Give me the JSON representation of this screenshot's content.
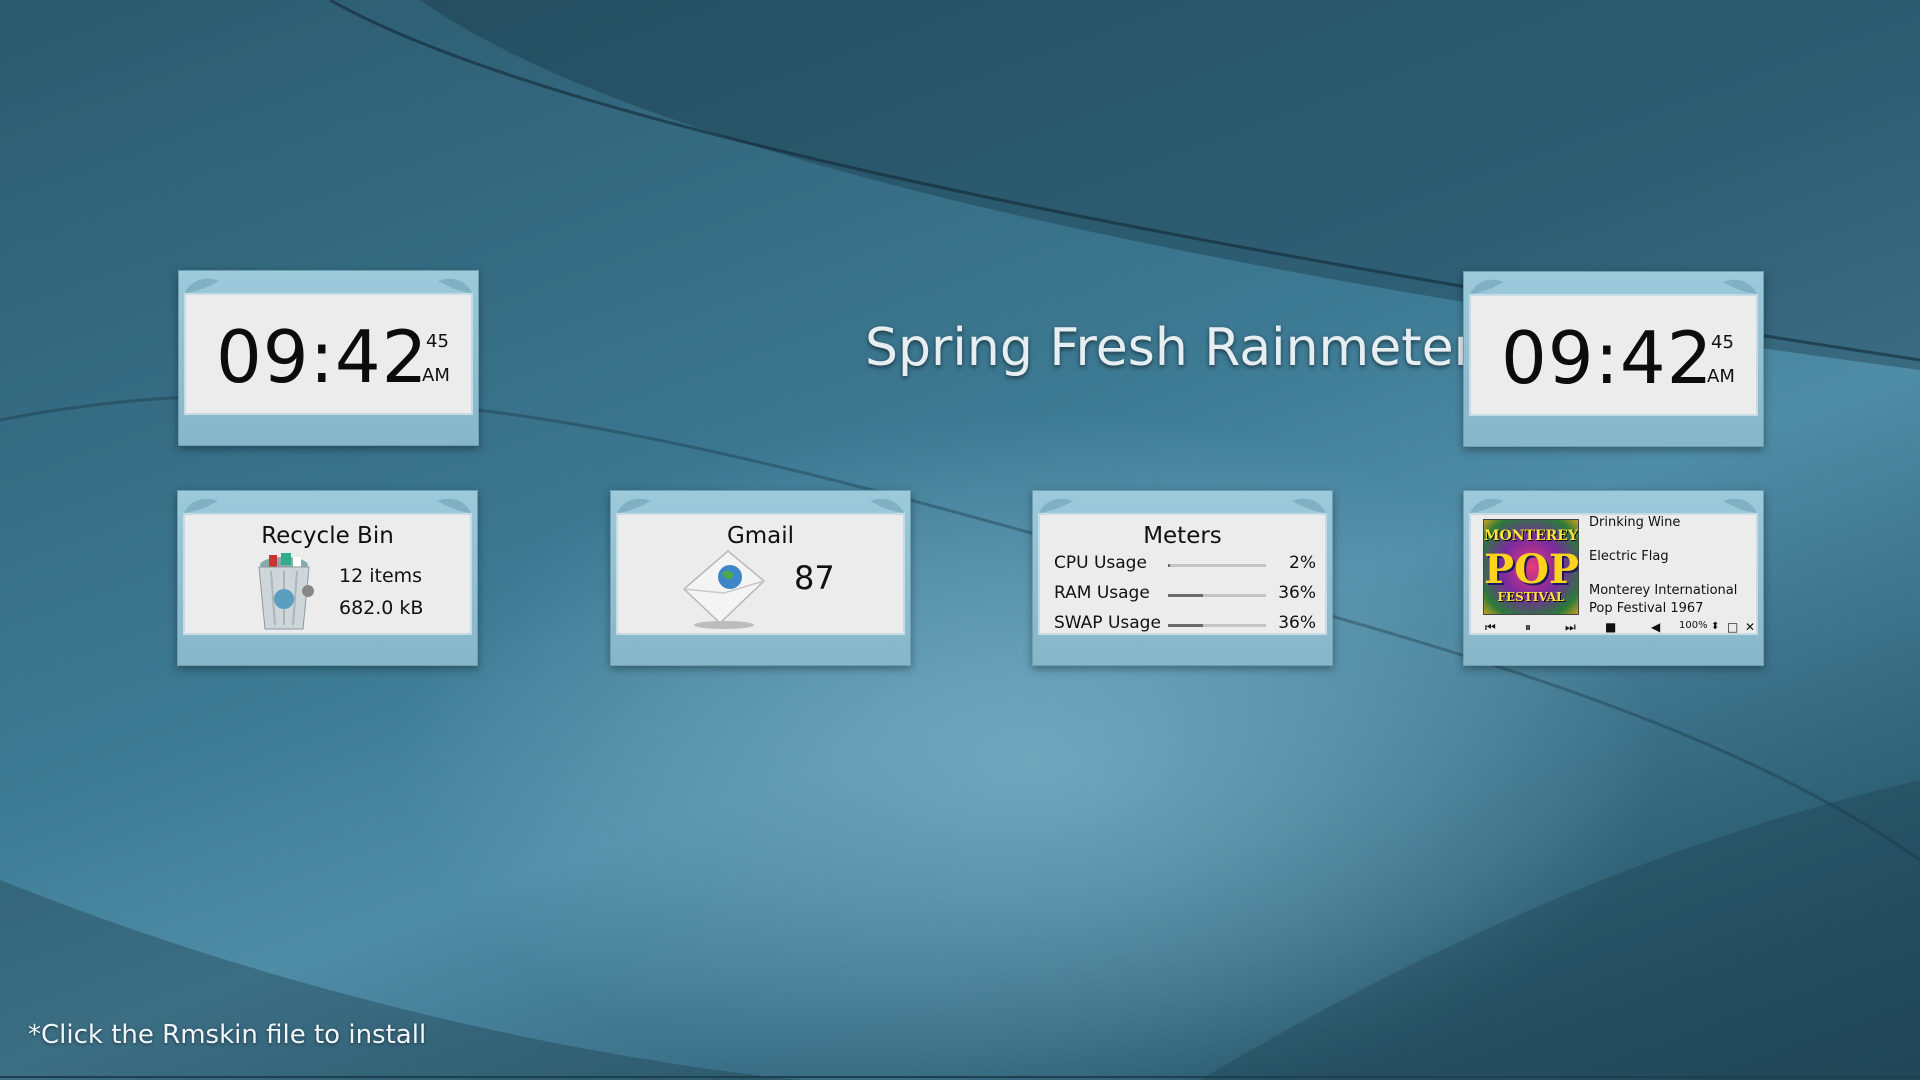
{
  "title": "Spring Fresh Rainmeter",
  "install_note": "*Click the Rmskin file to install",
  "clock_left": {
    "time": "09:42",
    "seconds": "45",
    "ampm": "AM"
  },
  "clock_right": {
    "time": "09:42",
    "seconds": "45",
    "ampm": "AM"
  },
  "recycle_bin": {
    "title": "Recycle Bin",
    "items": "12 items",
    "size": "682.0 kB",
    "icon": "recycle-bin-icon"
  },
  "gmail": {
    "title": "Gmail",
    "count": "87",
    "icon": "mail-envelope-icon"
  },
  "meters": {
    "title": "Meters",
    "rows": [
      {
        "label": "CPU Usage",
        "value": "2%",
        "fraction": 0.02
      },
      {
        "label": "RAM Usage",
        "value": "36%",
        "fraction": 0.36
      },
      {
        "label": "SWAP Usage",
        "value": "36%",
        "fraction": 0.36
      }
    ]
  },
  "player": {
    "track": "Drinking Wine",
    "artist": "Electric Flag",
    "album_line1": "Monterey International",
    "album_line2": "Pop Festival 1967",
    "volume": "100%",
    "album_art_text": {
      "top": "MONTEREY",
      "main": "POP",
      "bottom": "FESTIVAL"
    },
    "controls": [
      "previous-icon",
      "pause-icon",
      "next-icon",
      "stop-icon",
      "volume-icon",
      "volume-updown-icon",
      "window-icon",
      "close-icon"
    ]
  },
  "colors": {
    "frame": "#9ccadb",
    "panel": "#ececec",
    "background": "#3d7a93"
  }
}
